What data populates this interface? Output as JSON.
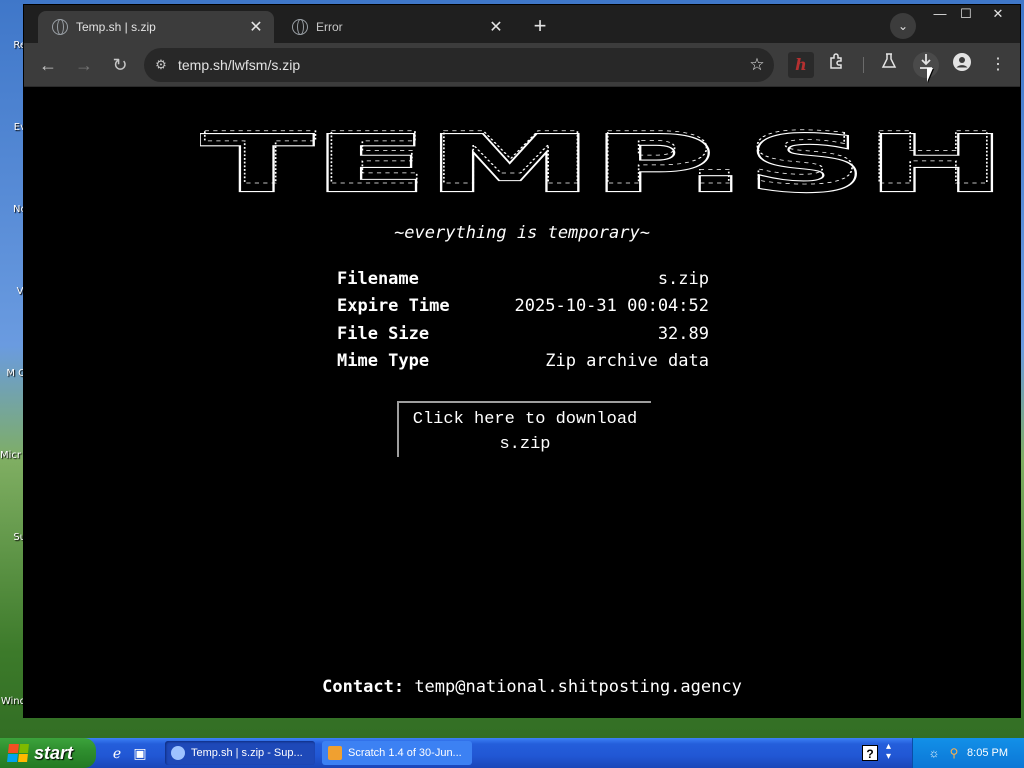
{
  "desktop": {
    "labels": [
      "Re",
      "Ev",
      "Nc",
      "Vi",
      "M O",
      "Micr Sto",
      "Su",
      "Wind"
    ]
  },
  "browser": {
    "tabs": [
      {
        "title": "Temp.sh | s.zip",
        "active": true
      },
      {
        "title": "Error",
        "active": false
      }
    ],
    "new_tab_label": "+",
    "tab_search_label": "⌄",
    "window_controls": {
      "minimize": "—",
      "maximize": "☐",
      "close": "✕"
    },
    "toolbar": {
      "back": "←",
      "forward": "→",
      "reload": "↻",
      "url": "temp.sh/lwfsm/s.zip",
      "extension_label": "h"
    }
  },
  "page": {
    "logo_text": "TEMP.SH",
    "tagline": "~everything is temporary~",
    "file_info": [
      {
        "key": "Filename",
        "value": "s.zip"
      },
      {
        "key": "Expire Time",
        "value": "2025-10-31 00:04:52"
      },
      {
        "key": "File Size",
        "value": "32.89"
      },
      {
        "key": "Mime Type",
        "value": "Zip archive data"
      }
    ],
    "download_button": {
      "line1": "Click here to download",
      "line2": "s.zip"
    },
    "contact": {
      "label": "Contact:",
      "email": "temp@national.shitposting.agency"
    }
  },
  "taskbar": {
    "start_label": "start",
    "tasks": [
      {
        "label": "Temp.sh | s.zip - Sup...",
        "active": true
      },
      {
        "label": "Scratch 1.4 of 30-Jun...",
        "active": false
      }
    ],
    "clock": "8:05 PM"
  },
  "colors": {
    "page_bg": "#000000",
    "page_text": "#ffffff",
    "chrome_dark": "#1f1f1f",
    "chrome_toolbar": "#3c3c3c",
    "xp_taskbar": "#245edb",
    "xp_start": "#3ca33c"
  }
}
